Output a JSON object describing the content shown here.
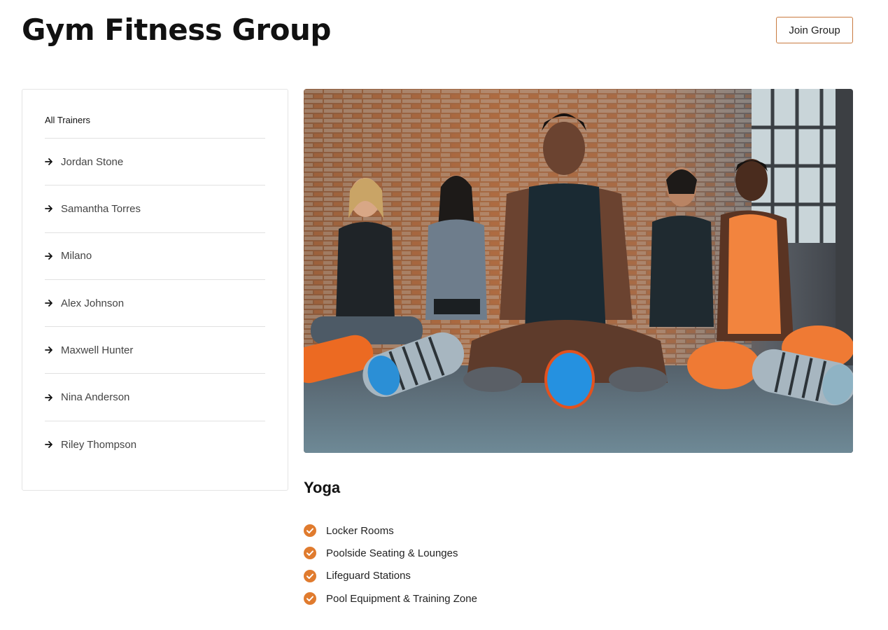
{
  "header": {
    "title": "Gym Fitness Group",
    "join_label": "Join Group"
  },
  "sidebar": {
    "heading": "All Trainers",
    "items": [
      {
        "label": "Jordan Stone",
        "icon": "arrow-right-icon"
      },
      {
        "label": "Samantha Torres",
        "icon": "arrow-right-icon"
      },
      {
        "label": "Milano",
        "icon": "arrow-right-icon"
      },
      {
        "label": "Alex Johnson",
        "icon": "arrow-right-icon"
      },
      {
        "label": "Maxwell Hunter",
        "icon": "arrow-right-icon"
      },
      {
        "label": "Nina Anderson",
        "icon": "arrow-right-icon"
      },
      {
        "label": "Riley Thompson",
        "icon": "arrow-right-icon"
      }
    ]
  },
  "main": {
    "class_title": "Yoga",
    "amenities": [
      {
        "label": "Locker Rooms",
        "icon": "check-circle-icon"
      },
      {
        "label": "Poolside Seating & Lounges",
        "icon": "check-circle-icon"
      },
      {
        "label": "Lifeguard Stations",
        "icon": "check-circle-icon"
      },
      {
        "label": "Pool Equipment & Training Zone",
        "icon": "check-circle-icon"
      }
    ]
  },
  "colors": {
    "accent": "#e07b2e",
    "button_border": "#c97a3f",
    "divider": "#e1e1e1"
  }
}
